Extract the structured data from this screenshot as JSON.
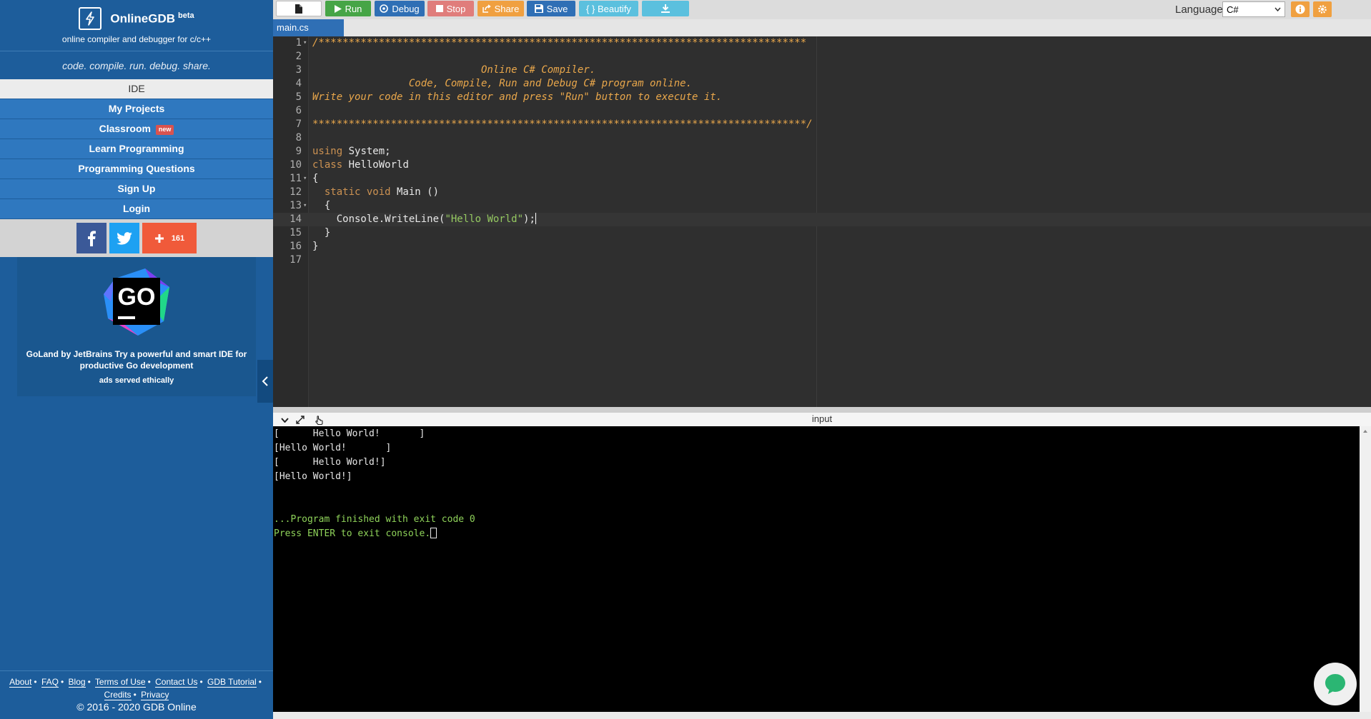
{
  "brand": {
    "name": "OnlineGDB",
    "badge": "beta",
    "subtitle": "online compiler and debugger for c/c++",
    "tagline": "code. compile. run. debug. share."
  },
  "nav": {
    "items": [
      {
        "label": "IDE",
        "active": true
      },
      {
        "label": "My Projects"
      },
      {
        "label": "Classroom",
        "badge": "new"
      },
      {
        "label": "Learn Programming"
      },
      {
        "label": "Programming Questions"
      },
      {
        "label": "Sign Up"
      },
      {
        "label": "Login"
      }
    ]
  },
  "social": {
    "share_count": "161",
    "colors": {
      "facebook": "#3b5998",
      "twitter": "#1da1f2",
      "plus": "#f05a3a"
    }
  },
  "ad": {
    "logo_text": "GO",
    "text": "GoLand by JetBrains Try a powerful and smart IDE for productive Go development",
    "ethical": "ads served ethically"
  },
  "footer": {
    "links": [
      "About",
      "FAQ",
      "Blog",
      "Terms of Use",
      "Contact Us",
      "GDB Tutorial"
    ],
    "links2": [
      "Credits",
      "Privacy"
    ],
    "copyright": "© 2016 - 2020 GDB Online"
  },
  "toolbar": {
    "run_label": "Run",
    "debug_label": "Debug",
    "stop_label": "Stop",
    "share_label": "Share",
    "save_label": "Save",
    "beautify_label": "{ } Beautify",
    "language_label": "Language",
    "language_value": "C#"
  },
  "editor": {
    "file_tab": "main.cs",
    "lines": [
      {
        "n": "1",
        "fold": true,
        "seg": [
          {
            "t": "/*********************************************************************************",
            "c": "com"
          }
        ]
      },
      {
        "n": "2",
        "seg": []
      },
      {
        "n": "3",
        "seg": [
          {
            "t": "                            Online C# Compiler.",
            "c": "com"
          }
        ]
      },
      {
        "n": "4",
        "seg": [
          {
            "t": "                Code, Compile, Run and Debug C# program online.",
            "c": "com"
          }
        ]
      },
      {
        "n": "5",
        "seg": [
          {
            "t": "Write your code in this editor and press \"Run\" button to execute it.",
            "c": "com"
          }
        ]
      },
      {
        "n": "6",
        "seg": []
      },
      {
        "n": "7",
        "seg": [
          {
            "t": "**********************************************************************************/",
            "c": "com"
          }
        ]
      },
      {
        "n": "8",
        "seg": []
      },
      {
        "n": "9",
        "seg": [
          {
            "t": "using",
            "c": "kw"
          },
          {
            "t": " System;",
            "c": "plain"
          }
        ]
      },
      {
        "n": "10",
        "seg": [
          {
            "t": "class",
            "c": "kw"
          },
          {
            "t": " HelloWorld",
            "c": "plain"
          }
        ]
      },
      {
        "n": "11",
        "fold": true,
        "seg": [
          {
            "t": "{",
            "c": "plain"
          }
        ]
      },
      {
        "n": "12",
        "seg": [
          {
            "t": "  static void",
            "c": "kw"
          },
          {
            "t": " Main ()",
            "c": "plain"
          }
        ]
      },
      {
        "n": "13",
        "fold": true,
        "seg": [
          {
            "t": "  {",
            "c": "plain"
          }
        ]
      },
      {
        "n": "14",
        "active": true,
        "cursor": true,
        "seg": [
          {
            "t": "    Console.WriteLine(",
            "c": "plain"
          },
          {
            "t": "\"Hello World\"",
            "c": "str"
          },
          {
            "t": ");",
            "c": "plain"
          }
        ]
      },
      {
        "n": "15",
        "seg": [
          {
            "t": "  }",
            "c": "plain"
          }
        ]
      },
      {
        "n": "16",
        "seg": [
          {
            "t": "}",
            "c": "plain"
          }
        ]
      },
      {
        "n": "17",
        "seg": []
      }
    ]
  },
  "console": {
    "title": "input",
    "output": [
      "[      Hello World!       ]",
      "[Hello World!       ]",
      "[      Hello World!]",
      "[Hello World!]",
      "",
      "",
      "...Program finished with exit code 0",
      "Press ENTER to exit console."
    ]
  }
}
